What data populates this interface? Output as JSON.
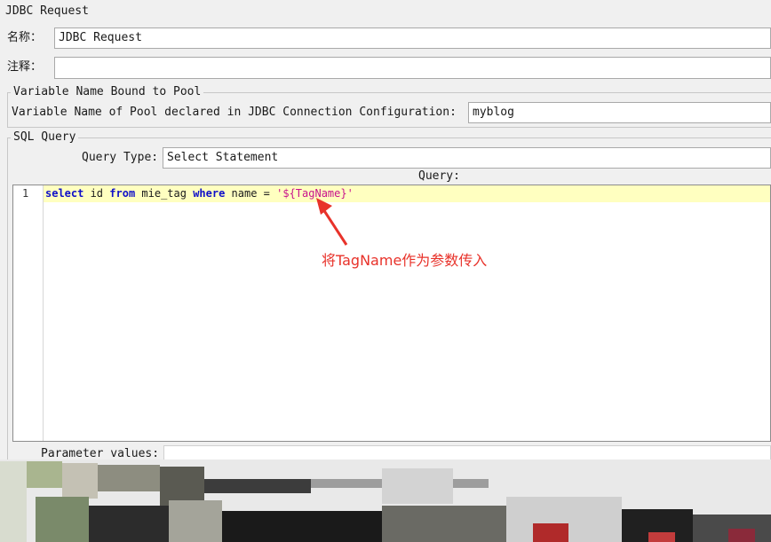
{
  "panel_title": "JDBC Request",
  "name_label": "名称：",
  "name_value": "JDBC Request",
  "comments_label": "注释：",
  "comments_value": "",
  "pool_group": {
    "title": "Variable Name Bound to Pool",
    "label": "Variable Name of Pool declared in JDBC Connection Configuration:",
    "value": "myblog"
  },
  "sql_group": {
    "title": "SQL Query",
    "query_type_label": "Query Type:",
    "query_type_value": "Select Statement",
    "query_label": "Query:"
  },
  "editor": {
    "line_number": "1",
    "tokens": {
      "t1": "select",
      "t2": " id ",
      "t3": "from",
      "t4": " mie_tag ",
      "t5": "where",
      "t6": " name = ",
      "t7": "'${TagName}'"
    }
  },
  "annotation": "将TagName作为参数传入",
  "parameter_values_label": "Parameter values:",
  "colors": {
    "keyword": "#1010c8",
    "string": "#c8148c",
    "current_line": "#ffffc0",
    "annotation": "#e8322a"
  }
}
